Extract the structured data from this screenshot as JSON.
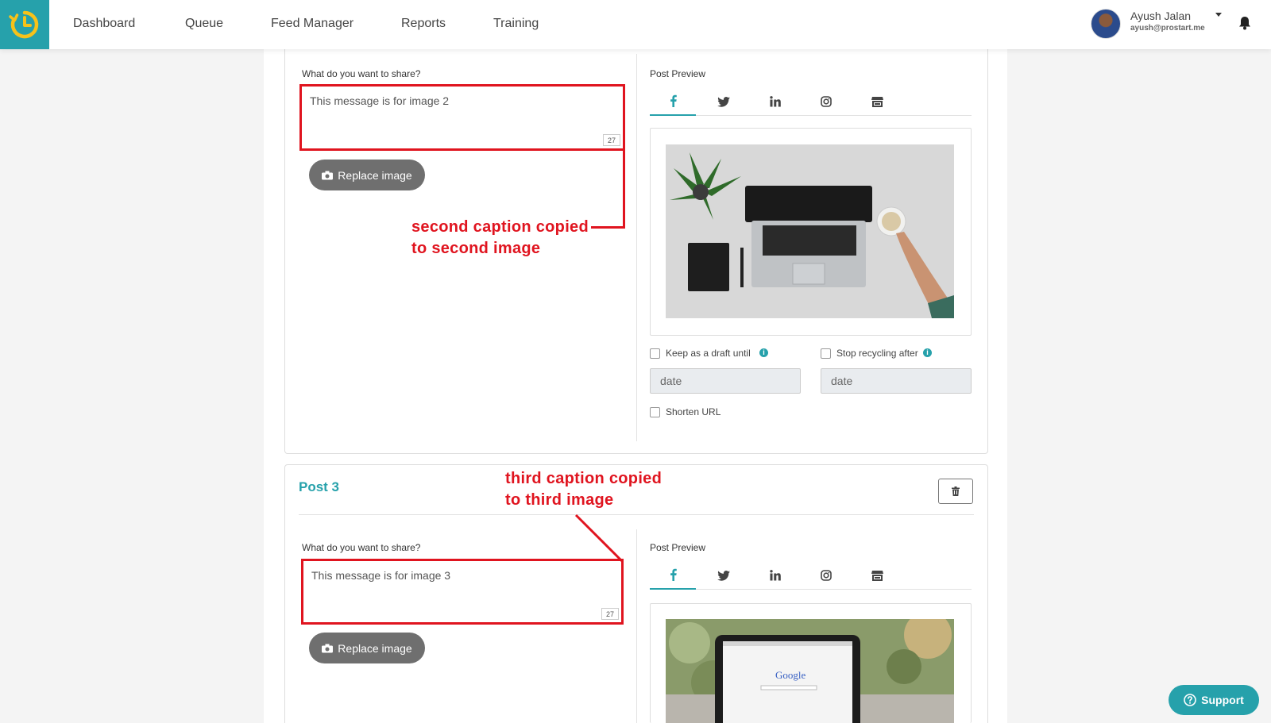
{
  "nav": {
    "items": [
      {
        "label": "Dashboard"
      },
      {
        "label": "Queue"
      },
      {
        "label": "Feed Manager"
      },
      {
        "label": "Reports"
      },
      {
        "label": "Training"
      }
    ]
  },
  "user": {
    "name": "Ayush Jalan",
    "email": "ayush@prostart.me"
  },
  "post2": {
    "share_label": "What do you want to share?",
    "message": "This message is for image 2",
    "char_count": "27",
    "replace_label": "Replace image",
    "preview_label": "Post Preview",
    "tabs": [
      "facebook-icon",
      "twitter-icon",
      "linkedin-icon",
      "instagram-icon",
      "google-my-business-icon"
    ],
    "keep_draft_label": "Keep as a draft until",
    "stop_recycling_label": "Stop recycling after",
    "date_placeholder": "date",
    "shorten_url_label": "Shorten URL"
  },
  "post3": {
    "title": "Post 3",
    "share_label": "What do you want to share?",
    "message": "This message is for image 3",
    "char_count": "27",
    "replace_label": "Replace image",
    "preview_label": "Post Preview"
  },
  "annotations": {
    "second_line1": "second caption copied",
    "second_line2": "to second image",
    "third_line1": "third caption copied",
    "third_line2": "to third image"
  },
  "support": {
    "label": "Support"
  },
  "colors": {
    "accent": "#26a1ab",
    "annotation": "#e0141f"
  }
}
